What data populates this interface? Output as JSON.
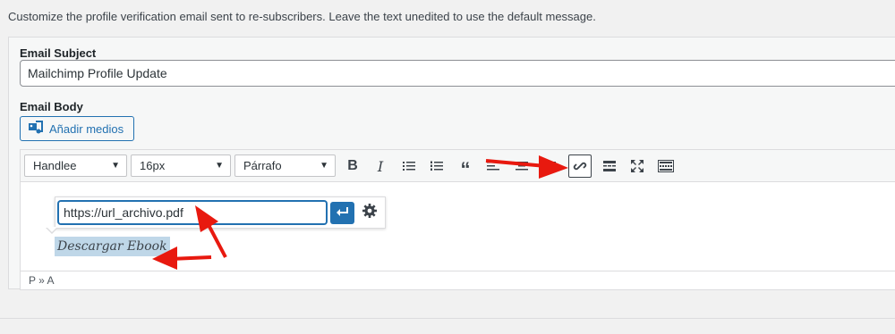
{
  "intro_text": "Customize the profile verification email sent to re-subscribers. Leave the text unedited to use the default message.",
  "subject": {
    "label": "Email Subject",
    "value": "Mailchimp Profile Update"
  },
  "body": {
    "label": "Email Body",
    "media_button": "Añadir medios"
  },
  "toolbar": {
    "font_family": "Handlee",
    "font_size": "16px",
    "format": "Párrafo",
    "bold_glyph": "B",
    "italic_glyph": "I",
    "quote_glyph": "“"
  },
  "link_popup": {
    "url_value": "https://url_archivo.pdf"
  },
  "content": {
    "link_text": "Descargar Ebook"
  },
  "statusbar": {
    "path": "P » A"
  },
  "colors": {
    "accent": "#2271b1",
    "annotation": "#e8190f",
    "highlight": "#bfd7e8"
  },
  "icons": [
    "media-icon",
    "caret-down-icon",
    "bold-icon",
    "italic-icon",
    "bullet-list-icon",
    "numbered-list-icon",
    "blockquote-icon",
    "align-left-icon",
    "align-center-icon",
    "align-right-icon",
    "link-icon",
    "read-more-icon",
    "fullscreen-icon",
    "toolbar-toggle-icon",
    "enter-icon",
    "gear-icon"
  ]
}
